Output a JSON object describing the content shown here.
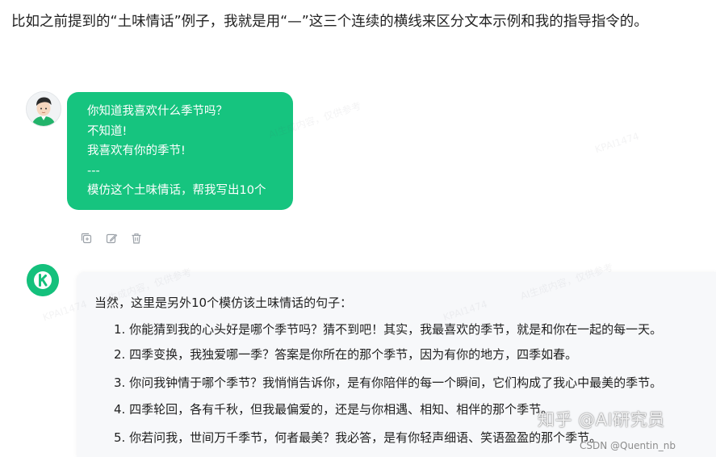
{
  "article": {
    "intro": "比如之前提到的“土味情话”例子，我就是用“—”这三个连续的横线来区分文本示例和我的指导指令的。"
  },
  "user_message": {
    "lines": [
      "你知道我喜欢什么季节吗？",
      "不知道!",
      "我喜欢有你的季节!",
      "---",
      "模仿这个土味情话，帮我写出10个"
    ],
    "avatar_icon": "user-avatar-icon"
  },
  "message_actions": {
    "icons": [
      "copy-icon",
      "edit-icon",
      "delete-icon"
    ]
  },
  "bot_message": {
    "avatar_icon": "kimi-logo-icon",
    "intro": "当然，这里是另外10个模仿该土味情话的句子：",
    "items": [
      "1. 你能猜到我的心头好是哪个季节吗？猜不到吧！其实，我最喜欢的季节，就是和你在一起的每一天。",
      "2. 四季变换，我独爱哪一季？答案是你所在的那个季节，因为有你的地方，四季如春。",
      "3. 你问我钟情于哪个季节？我悄悄告诉你，是有你陪伴的每一个瞬间，它们构成了我心中最美的季节。",
      "4. 四季轮回，各有千秋，但我最偏爱的，还是与你相遇、相知、相伴的那个季节。",
      "5. 你若问我，世间万千季节，何者最美？我必答，是有你轻声细语、笑语盈盈的那个季节。"
    ]
  },
  "watermarks": {
    "text_a": "AI生成内容，仅供参考",
    "text_b": "KPAI1474"
  },
  "overlays": {
    "brand": "知乎 @AI研究员",
    "credit": "CSDN @Quentin_nb"
  },
  "colors": {
    "accent_green": "#16c47f",
    "card_background": "#f7f8fa"
  }
}
